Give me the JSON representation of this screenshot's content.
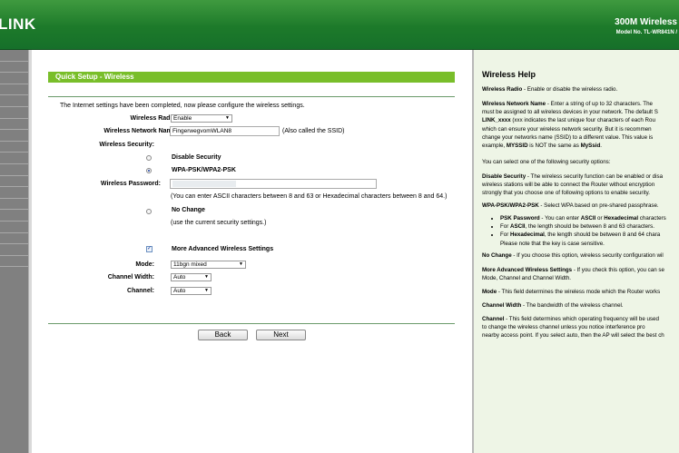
{
  "header": {
    "logo": "LINK",
    "product": "300M Wireless",
    "model": "Model No. TL-WR841N /"
  },
  "menu": {
    "items": [
      "",
      "",
      "",
      "",
      "",
      "",
      "",
      "",
      "",
      "",
      "",
      "",
      "",
      "",
      "",
      "",
      "",
      "",
      ""
    ]
  },
  "wizard": {
    "title": "Quick Setup - Wireless",
    "intro": "The Internet settings have been completed, now please configure the wireless settings.",
    "radio_label": "Wireless Radio:",
    "radio_value": "Enable",
    "ssid_label": "Wireless Network Name:",
    "ssid_value": "FingerwegvomWLAN8",
    "ssid_note": "(Also called the SSID)",
    "security_label": "Wireless Security:",
    "sec_disable": "Disable Security",
    "sec_wpa": "WPA-PSK/WPA2-PSK",
    "password_label": "Wireless Password:",
    "password_value": "",
    "password_note": "(You can enter ASCII characters between 8 and 63 or Hexadecimal characters between 8 and 64.)",
    "sec_nochange": "No Change",
    "nochange_note": "(use the current security settings.)",
    "advanced_label": "More Advanced Wireless Settings",
    "mode_label": "Mode:",
    "mode_value": "11bgn mixed",
    "width_label": "Channel Width:",
    "width_value": "Auto",
    "channel_label": "Channel:",
    "channel_value": "Auto",
    "back": "Back",
    "next": "Next"
  },
  "help": {
    "title": "Wireless Help",
    "p1_b": "Wireless Radio",
    "p1": " - Enable or disable the wireless radio.",
    "p2_b": "Wireless Network Name",
    "p2": " - Enter a string of up to 32 characters. The",
    "p2_l2": "must be assigned to all wireless devices in your network. The default S",
    "p2_l3b": "LINK_xxxx",
    "p2_l3": " (xxx indicates the last unique four characters of each Rou",
    "p2_l4": "which can ensure your wireless network security. But it is recommen",
    "p2_l5": "change your networks name (SSID) to a different value. This value is",
    "p2_l6a": "example, ",
    "p2_l6b": "MYSSID",
    "p2_l6c": " is NOT the same as ",
    "p2_l6d": "MySsid",
    "p2_l6e": ".",
    "p3": "You can select one of the following security options:",
    "p4_b": "Disable Security",
    "p4": " - The wireless security function can be enabled or disa",
    "p4_l2": "wireless stations will be able to connect the Router without encryption",
    "p4_l3": "strongly that you choose one of following options to enable security.",
    "p5_b": "WPA-PSK/WPA2-PSK",
    "p5": " - Select WPA based on pre-shared passphrase.",
    "li1_b": "PSK Password",
    "li1": " - You can enter ",
    "li1_b2": "ASCII",
    "li1_c": " or ",
    "li1_b3": "Hexadecimal",
    "li1_d": " characters",
    "li2a": "For ",
    "li2_b": "ASCII",
    "li2": ", the length should be between 8 and 63 characters.",
    "li3a": "For ",
    "li3_b": "Hexadecimal",
    "li3": ", the length should be between 8 and 64 chara",
    "li3_l2": "Please note that the key is case sensitive.",
    "p6_b": "No Change",
    "p6": " - If you choose this option, wireless security configuration wil",
    "p7_b": "More Advanced Wireless Settings",
    "p7": " - If you check this option, you can se",
    "p7_l2": "Mode, Channel and Channel Width.",
    "p8_b": "Mode",
    "p8": " - This field determines the wireless mode which the Router works",
    "p9_b": "Channel Width",
    "p9": " - The bandwidth of the wireless channel.",
    "p10_b": "Channel",
    "p10": " - This field determines which operating frequency will be used",
    "p10_l2": "to change the wireless channel unless you notice interference pro",
    "p10_l3": "nearby access point. If you select auto, then the AP will select the best ch"
  }
}
